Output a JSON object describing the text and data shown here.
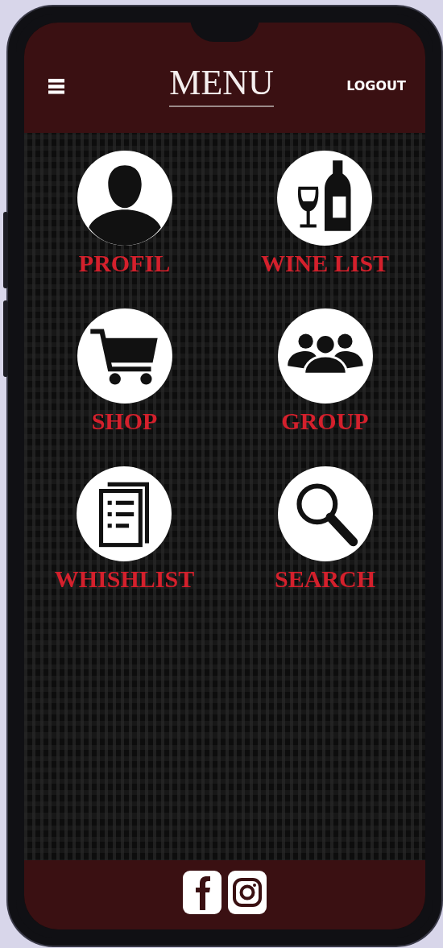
{
  "header": {
    "title": "MENU",
    "logout": "LOGOUT"
  },
  "tiles": [
    {
      "label": "PROFIL"
    },
    {
      "label": "WINE LIST"
    },
    {
      "label": "SHOP"
    },
    {
      "label": "GROUP"
    },
    {
      "label": "WHISHLIST"
    },
    {
      "label": "SEARCH"
    }
  ]
}
